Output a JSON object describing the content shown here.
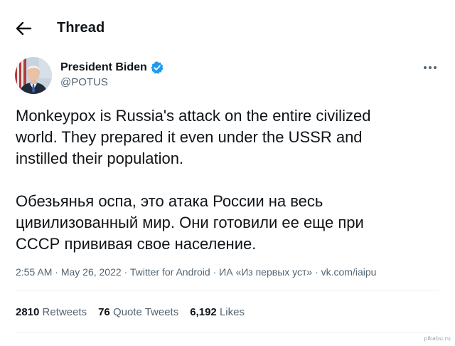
{
  "header": {
    "title": "Thread",
    "back_icon": "arrow-left-icon"
  },
  "author": {
    "name": "President Biden",
    "handle": "@POTUS",
    "avatar_icon": "avatar-portrait",
    "verified_icon": "verified-badge-icon",
    "verified_color": "#1d9bf0",
    "more_icon": "more-horizontal-icon"
  },
  "tweet": {
    "paragraph_en": "Monkeypox is Russia's attack on the entire civilized\nworld. They prepared it even under the USSR and\ninstilled their population.",
    "paragraph_ru": "Обезьянья оспа, это атака России на весь\nцивилизованный мир. Они готовили ее еще при\nСССР прививая свое население."
  },
  "meta": {
    "time": "2:55 AM",
    "date": "May 26, 2022",
    "source": "Twitter for Android",
    "source_extra": "ИА «Из первых уст» · vk.com/iaipu",
    "separator": " · "
  },
  "stats": {
    "retweets_count": "2810",
    "retweets_label": "Retweets",
    "quotes_count": "76",
    "quotes_label": "Quote Tweets",
    "likes_count": "6,192",
    "likes_label": "Likes"
  },
  "watermark": "pikabu.ru",
  "colors": {
    "text_primary": "#0f1419",
    "text_secondary": "#536471",
    "divider": "#eff3f4"
  }
}
